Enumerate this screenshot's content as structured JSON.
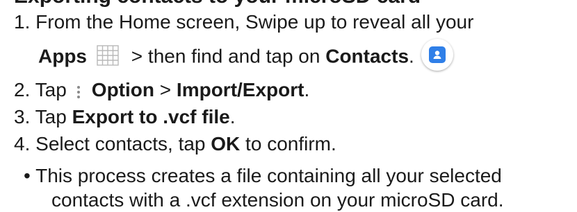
{
  "heading_fragment": "Exporting contacts to your microSD card",
  "steps": [
    {
      "number": "1.",
      "line1": "From the Home screen, Swipe up to reveal all your",
      "apps_label": "Apps",
      "middle_text": " > then find and tap on ",
      "contacts_label": "Contacts",
      "end": "."
    },
    {
      "number": "2.",
      "pre": "Tap",
      "option_label": "Option",
      "sep": " > ",
      "import_label": "Import/Export",
      "end": "."
    },
    {
      "number": "3.",
      "pre": "Tap ",
      "export_label": "Export to .vcf file",
      "end": "."
    },
    {
      "number": "4.",
      "pre": "Select contacts, tap ",
      "ok_label": "OK",
      "post": " to confirm."
    }
  ],
  "note": {
    "bullet": "•",
    "line1": "This process creates a file containing all your selected",
    "line2": "contacts with a .vcf extension on your microSD card."
  },
  "icons": {
    "apps": "apps-grid-icon",
    "contacts": "contacts-app-icon",
    "options": "more-options-icon"
  },
  "colors": {
    "text": "#1a1a1a",
    "icon_grid": "#b8b8b8",
    "contacts_blue": "#2f7fe8",
    "options_dots": "#8a8a8a"
  }
}
